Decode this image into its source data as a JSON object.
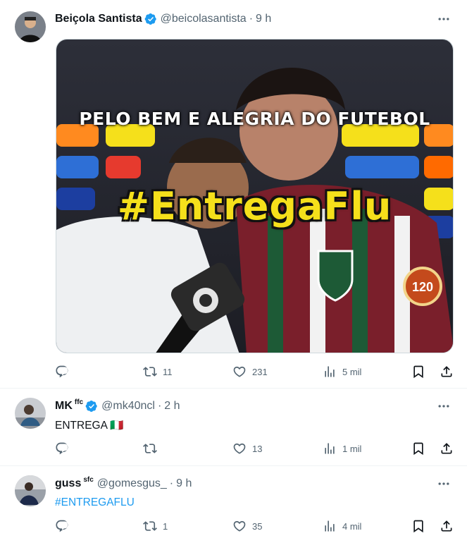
{
  "tweets": [
    {
      "name": "Beiçola Santista",
      "handle": "@beicolasantista",
      "time": "9 h",
      "image_caption": "PELO BEM E ALEGRIA DO FUTEBOL",
      "image_hashtag": "#EntregaFlu",
      "replies": "",
      "retweets": "11",
      "likes": "231",
      "views": "5 mil"
    },
    {
      "name": "MK",
      "badge": "ffc",
      "handle": "@mk40ncl",
      "time": "2 h",
      "text": "ENTREGA 🇮🇹",
      "replies": "",
      "retweets": "",
      "likes": "13",
      "views": "1 mil"
    },
    {
      "name": "guss",
      "badge": "sfc",
      "handle": "@gomesgus_",
      "time": "9 h",
      "text": "#ENTREGAFLU",
      "replies": "",
      "retweets": "1",
      "likes": "35",
      "views": "4 mil"
    }
  ],
  "colors": {
    "accent": "#1d9bf0",
    "secondary_text": "#536471",
    "primary_text": "#0f1419",
    "hashtag_yellow": "#f5e01b"
  }
}
